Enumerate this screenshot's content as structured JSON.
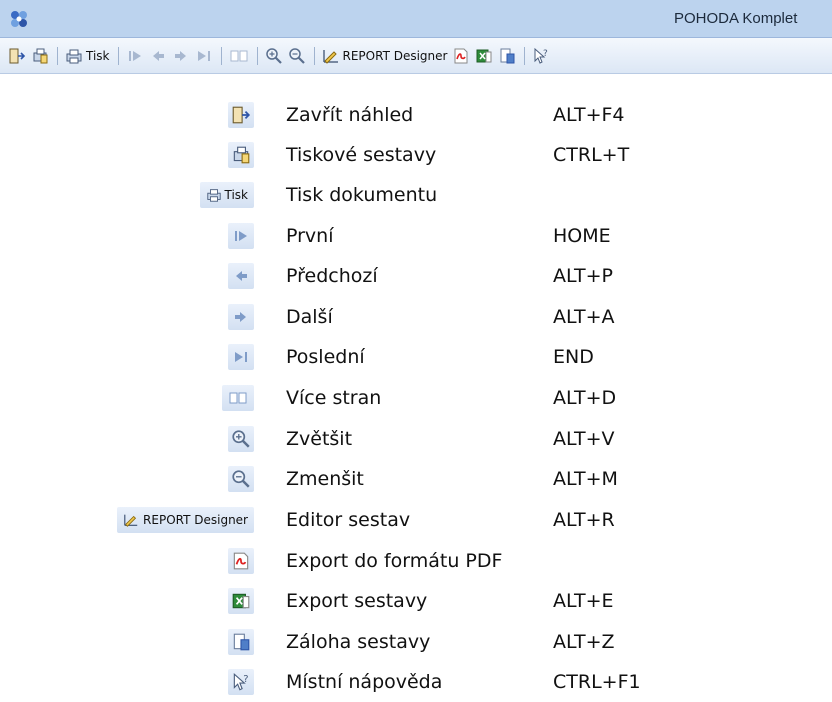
{
  "window": {
    "title": "POHODA Komplet"
  },
  "toolbar": {
    "print_label": "Tisk",
    "report_designer_label": "REPORT Designer"
  },
  "legend": [
    {
      "icon": "close-preview-icon",
      "label": "Zavřít náhled",
      "shortcut": "ALT+F4"
    },
    {
      "icon": "print-reports-icon",
      "label": "Tiskové sestavy",
      "shortcut": "CTRL+T"
    },
    {
      "icon": "print-icon",
      "button_text": "Tisk",
      "label": "Tisk dokumentu",
      "shortcut": ""
    },
    {
      "icon": "first-page-icon",
      "label": "První",
      "shortcut": "HOME"
    },
    {
      "icon": "previous-page-icon",
      "label": "Předchozí",
      "shortcut": "ALT+P"
    },
    {
      "icon": "next-page-icon",
      "label": "Další",
      "shortcut": "ALT+A"
    },
    {
      "icon": "last-page-icon",
      "label": "Poslední",
      "shortcut": "END"
    },
    {
      "icon": "multiple-pages-icon",
      "label": "Více stran",
      "shortcut": "ALT+D"
    },
    {
      "icon": "zoom-in-icon",
      "label": "Zvětšit",
      "shortcut": "ALT+V"
    },
    {
      "icon": "zoom-out-icon",
      "label": "Zmenšit",
      "shortcut": "ALT+M"
    },
    {
      "icon": "report-designer-icon",
      "button_text": "REPORT Designer",
      "label": "Editor sestav",
      "shortcut": "ALT+R"
    },
    {
      "icon": "pdf-export-icon",
      "label": "Export do formátu PDF",
      "shortcut": ""
    },
    {
      "icon": "excel-export-icon",
      "label": "Export sestavy",
      "shortcut": "ALT+E"
    },
    {
      "icon": "backup-report-icon",
      "label": "Záloha sestavy",
      "shortcut": "ALT+Z"
    },
    {
      "icon": "context-help-icon",
      "label": "Místní nápověda",
      "shortcut": "CTRL+F1"
    }
  ]
}
